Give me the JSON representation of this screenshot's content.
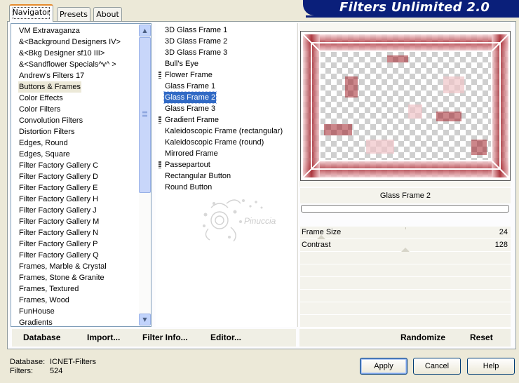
{
  "app": {
    "title": "Filters Unlimited 2.0"
  },
  "tabs": [
    {
      "label": "Navigator",
      "active": true
    },
    {
      "label": "Presets",
      "active": false
    },
    {
      "label": "About",
      "active": false
    }
  ],
  "categories": {
    "selected": "Buttons & Frames",
    "items": [
      "VM Extravaganza",
      "&<Background Designers IV>",
      "&<Bkg Designer sf10 III>",
      "&<Sandflower Specials^v^ >",
      "Andrew's Filters 17",
      "Buttons & Frames",
      "Color Effects",
      "Color Filters",
      "Convolution Filters",
      "Distortion Filters",
      "Edges, Round",
      "Edges, Square",
      "Filter Factory Gallery C",
      "Filter Factory Gallery D",
      "Filter Factory Gallery E",
      "Filter Factory Gallery H",
      "Filter Factory Gallery J",
      "Filter Factory Gallery M",
      "Filter Factory Gallery N",
      "Filter Factory Gallery P",
      "Filter Factory Gallery Q",
      "Frames, Marble & Crystal",
      "Frames, Stone & Granite",
      "Frames, Textured",
      "Frames, Wood",
      "FunHouse",
      "Gradients"
    ]
  },
  "filters": {
    "selected": "Glass Frame 2",
    "items": [
      {
        "label": "3D Glass Frame 1",
        "marker": false
      },
      {
        "label": "3D Glass Frame 2",
        "marker": false
      },
      {
        "label": "3D Glass Frame 3",
        "marker": false
      },
      {
        "label": "Bull's Eye",
        "marker": false
      },
      {
        "label": "Flower Frame",
        "marker": true
      },
      {
        "label": "Glass Frame 1",
        "marker": false
      },
      {
        "label": "Glass Frame 2",
        "marker": false
      },
      {
        "label": "Glass Frame 3",
        "marker": false
      },
      {
        "label": "Gradient Frame",
        "marker": true
      },
      {
        "label": "Kaleidoscopic Frame (rectangular)",
        "marker": false
      },
      {
        "label": "Kaleidoscopic Frame (round)",
        "marker": false
      },
      {
        "label": "Mirrored Frame",
        "marker": false
      },
      {
        "label": "Passepartout",
        "marker": true
      },
      {
        "label": "Rectangular Button",
        "marker": false
      },
      {
        "label": "Round Button",
        "marker": false
      }
    ]
  },
  "watermark": {
    "text": "Pinuccia"
  },
  "preview": {
    "filter_name": "Glass Frame 2",
    "frame_color": "#a3242c"
  },
  "params": [
    {
      "label": "Frame Size",
      "value": "24",
      "level": 0.094
    },
    {
      "label": "Contrast",
      "value": "128",
      "level": 0.5
    }
  ],
  "toolbar": {
    "database": "Database",
    "import": "Import...",
    "filter_info": "Filter Info...",
    "editor": "Editor...",
    "randomize": "Randomize",
    "reset": "Reset"
  },
  "footer": {
    "database_label": "Database:",
    "database_value": "ICNET-Filters",
    "filters_label": "Filters:",
    "filters_value": "524"
  },
  "buttons": {
    "apply": "Apply",
    "cancel": "Cancel",
    "help": "Help"
  },
  "colors": {
    "banner": "#0a1f7a",
    "selection": "#316ac5",
    "tab_highlight": "#e68b2c"
  }
}
